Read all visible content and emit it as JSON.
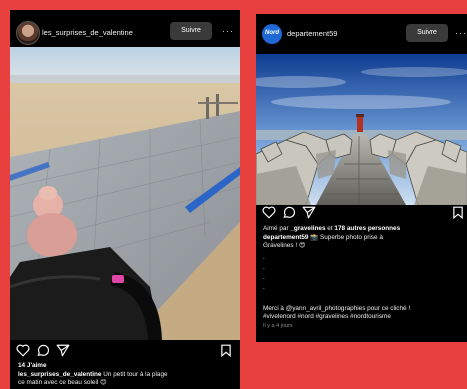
{
  "post_left": {
    "username": "les_surprises_de_valentine",
    "follow_label": "Suivre",
    "more": "···",
    "likes": "14 J'aime",
    "caption_user": "les_surprises_de_valentine",
    "caption_text": "Un petit tour à la plage",
    "caption_line2": "ce matin avec ce beau soleil 😊"
  },
  "post_right": {
    "username": "departement59",
    "avatar_label": "Nord",
    "follow_label": "Suivre",
    "more": "···",
    "liked_prefix": "Aimé par ",
    "liked_user": "_gravelines",
    "liked_middle": " et ",
    "liked_others": "178 autres personnes",
    "caption_user": "departement59",
    "caption_text": "📸 Superbe photo prise à",
    "caption_line2": "Gravelines ! 😍",
    "dots": [
      ".",
      ".",
      ".",
      "."
    ],
    "credit": "Merci à @yann_avril_photographies pour ce cliché !",
    "hashtags": "#vivelenord #nord #gravelines #nordtourisme",
    "time": "Il y a 4 jours"
  },
  "colors": {
    "background": "#e8403f",
    "card": "#000000",
    "follow_button": "#3a3a3a",
    "nord_blue": "#1f68d6"
  }
}
